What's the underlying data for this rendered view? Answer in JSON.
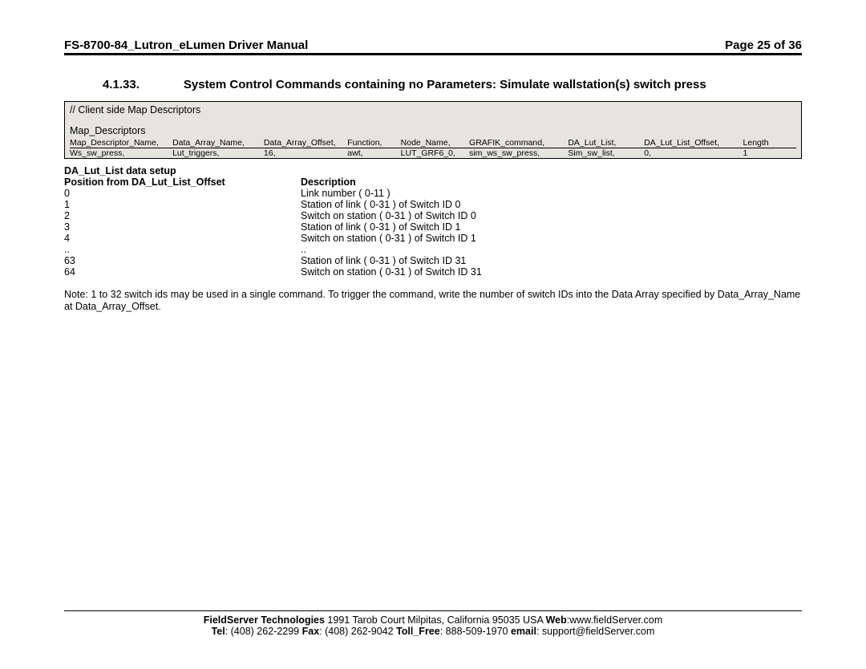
{
  "header": {
    "title": "FS-8700-84_Lutron_eLumen Driver Manual",
    "page": "Page 25 of 36"
  },
  "section": {
    "number": "4.1.33.",
    "title": "System Control Commands containing no Parameters: Simulate wallstation(s) switch press"
  },
  "mapbox": {
    "comment": "//    Client side Map Descriptors",
    "title": "Map_Descriptors",
    "headers": [
      "Map_Descriptor_Name,",
      "Data_Array_Name,",
      "Data_Array_Offset,",
      "Function,",
      "Node_Name,",
      "GRAFIK_command,",
      "DA_Lut_List,",
      "DA_Lut_List_Offset,",
      "Length"
    ],
    "values": [
      "Ws_sw_press,",
      "Lut_triggers,",
      "16,",
      "awt,",
      "LUT_GRF6_0,",
      "sim_ws_sw_press,",
      "Sim_sw_list,",
      "0,",
      "1"
    ]
  },
  "setup": {
    "h1": "DA_Lut_List data setup",
    "colA": "Position from DA_Lut_List_Offset",
    "colB": "Description",
    "rows": [
      {
        "a": "0",
        "b": "Link number ( 0-11 )"
      },
      {
        "a": "1",
        "b": "Station of link ( 0-31 ) of Switch ID 0"
      },
      {
        "a": "2",
        "b": "Switch on station ( 0-31 ) of Switch ID 0"
      },
      {
        "a": "3",
        "b": "Station of link ( 0-31 ) of Switch ID 1"
      },
      {
        "a": "4",
        "b": "Switch on station ( 0-31 ) of Switch ID 1"
      },
      {
        "a": "..",
        "b": ".."
      },
      {
        "a": "63",
        "b": "Station of link ( 0-31 ) of Switch ID 31"
      },
      {
        "a": "64",
        "b": "Switch on station ( 0-31 ) of Switch ID 31"
      }
    ]
  },
  "note": "Note: 1 to 32 switch ids may be used in a single command. To trigger the command, write the number of switch IDs into the Data Array specified by Data_Array_Name at Data_Array_Offset.",
  "footer": {
    "company": "FieldServer Technologies",
    "addr": " 1991 Tarob Court Milpitas, California 95035 USA  ",
    "webL": "Web",
    "web": ":www.fieldServer.com",
    "telL": "Tel",
    "tel": ": (408) 262-2299  ",
    "faxL": "Fax",
    "fax": ": (408) 262-9042  ",
    "tollL": "Toll_Free",
    "toll": ": 888-509-1970   ",
    "emailL": "email",
    "email": ": support@fieldServer.com"
  }
}
